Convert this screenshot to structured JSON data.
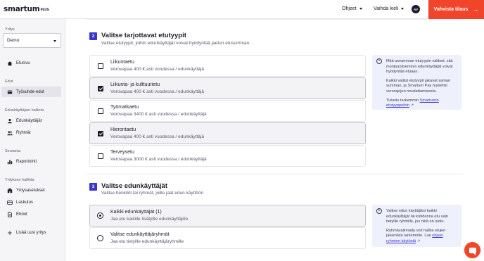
{
  "brand": {
    "logo": "smartum",
    "logo_sub": "PLUS",
    "accent": "#f0452b",
    "primary": "#3a36c9"
  },
  "header": {
    "help_label": "Ohjeet",
    "language_label": "Vaihda kieli",
    "avatar_initials": "AV",
    "confirm_label": "Vahvista tilaus",
    "confirm_icon": "arrow-right-icon"
  },
  "sidebar": {
    "company_heading": "Yritys",
    "company_value": "Demo",
    "items": [
      {
        "label": "Etusivu",
        "icon": "home-icon"
      },
      {
        "label": "Työsuhde-edut",
        "icon": "benefits-icon"
      },
      {
        "label": "Edunkäyttäjät",
        "icon": "user-icon"
      },
      {
        "label": "Ryhmät",
        "icon": "group-icon"
      },
      {
        "label": "Raportointi",
        "icon": "chart-icon"
      },
      {
        "label": "Yritysasetukset",
        "icon": "building-icon"
      },
      {
        "label": "Laskutus",
        "icon": "card-icon"
      },
      {
        "label": "Ehdot",
        "icon": "document-icon"
      },
      {
        "label": "Lisää uusi yritys",
        "icon": "plus-icon"
      }
    ],
    "headings": {
      "benefits": "Edut",
      "users": "Edunkäyttäjien hallinta",
      "tracking": "Seuranta",
      "company": "Yrityksen hallinta"
    }
  },
  "section2": {
    "step": "2",
    "title": "Valitse tarjottavat etutyypit",
    "subtitle": "Valitse etutyypit, joihin edunkäyttäjät voivat hyödyntää jaetun etusumman.",
    "options": [
      {
        "title": "Liikuntaetu",
        "desc": "Verovapaa 400 € asti vuodessa / edunkäyttäjä",
        "checked": false
      },
      {
        "title": "Liikunta- ja kulttuurietu",
        "desc": "Verovapaa 400 € asti vuodessa / edunkäyttäjä",
        "checked": true
      },
      {
        "title": "Työmatkaetu",
        "desc": "Verovapaa 3400 € asti vuodessa / edunkäyttäjä",
        "checked": false
      },
      {
        "title": "Hierontaetu",
        "desc": "Verovapaa 400 € asti vuodessa / edunkäyttäjä",
        "checked": true
      },
      {
        "title": "Terveysetu",
        "desc": "Verovapaa 3000 € asti vuodessa / edunkäyttäjä",
        "checked": false
      }
    ],
    "info": {
      "p1": "Mitä useamman etutyypin valitset, sitä monipuolisemmin edunkäyttäjät voivat hyödyntää etuaan.",
      "p2": "Kaikki valitut etutyypit jakavat saman summan, ja Smartum Pay huolehtii verorajojen noudattamisesta.",
      "p3_prefix": "Tutustu tarkemmin ",
      "p3_link": "Smartumin etutyyppeihin"
    }
  },
  "section3": {
    "step": "3",
    "title": "Valitse edunkäyttäjät",
    "subtitle": "Valitse henkilöt tai ryhmät, joille jaat edun käyttöön",
    "options": [
      {
        "title": "Kaikki edunkäyttäjät (1)",
        "desc": "Jaa etu kaikille lisätyille edunkäyttäjille",
        "selected": true
      },
      {
        "title": "Valitse edunkäyttäjäryhmät",
        "desc": "Jaa etu tietyille edunkäyttäjäryhmille",
        "selected": false
      }
    ],
    "info": {
      "p1": "Valitse edun käyttäjiksi kaikki edunkäyttäjät tai kohdenna etu vain tietyille ryhmille, jos niitä on luotu.",
      "p2_prefix": "Ryhmävalinnalla voit hallita etujen jakamista tarkemmin. Lue ",
      "p2_link": "ohjeet ryhmien käytöstä"
    }
  },
  "chat": {
    "icon": "chat-icon"
  }
}
